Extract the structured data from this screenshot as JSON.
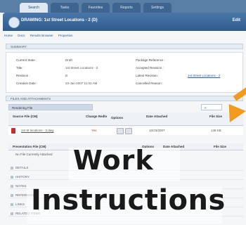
{
  "tabs": [
    "Search",
    "Tasks",
    "Favorites",
    "Reports",
    "Settings"
  ],
  "header": {
    "title": "DRAWING: 1st Street Locations - 2 (D)",
    "edit": "Edit"
  },
  "breadcrumbs": [
    "Home",
    "Docs",
    "Results Browser",
    "Properties"
  ],
  "summary": {
    "label": "SUMMARY",
    "fields": [
      {
        "label": "Current State :",
        "value": "Draft"
      },
      {
        "label": "Title :",
        "value": "1st Street Locations - 2"
      },
      {
        "label": "Revision :",
        "value": "D"
      },
      {
        "label": "Creation Date :",
        "value": "23-Jan-2007 11:01 AM"
      }
    ],
    "right_fields": [
      {
        "label": "Package Reference :",
        "value": ""
      },
      {
        "label": "Accepted Revision :",
        "value": ""
      },
      {
        "label": "Latest Revision :",
        "value": "1st Street Locations - 2"
      },
      {
        "label": "Cancelled Reason :",
        "value": ""
      }
    ]
  },
  "files_section": "FILES AND ATTACHMENTS",
  "doc_tab": "Rendering File",
  "grid": {
    "headers": [
      "Source File (CM)",
      "Change Redln",
      "Options",
      "Date Attached",
      "File Size"
    ],
    "row": {
      "name": "1st St locations - 2.dwg",
      "status": "Yes",
      "date": "10/23/2007",
      "size": "148 KB"
    }
  },
  "presentation": {
    "headers": [
      "Presentation File (CM)",
      "Options",
      "Date Attached",
      "File Size"
    ],
    "empty": "No File Currently Attached"
  },
  "side_sections": [
    "DETAILS",
    "HISTORY",
    "NOTES",
    "REFERENCES",
    "LINKS",
    "RELATED ITEMS"
  ],
  "overlay": {
    "line1": "Work",
    "line2": "Instructions"
  },
  "colors": {
    "accent": "#f29a1f",
    "header": "#3d6590"
  }
}
